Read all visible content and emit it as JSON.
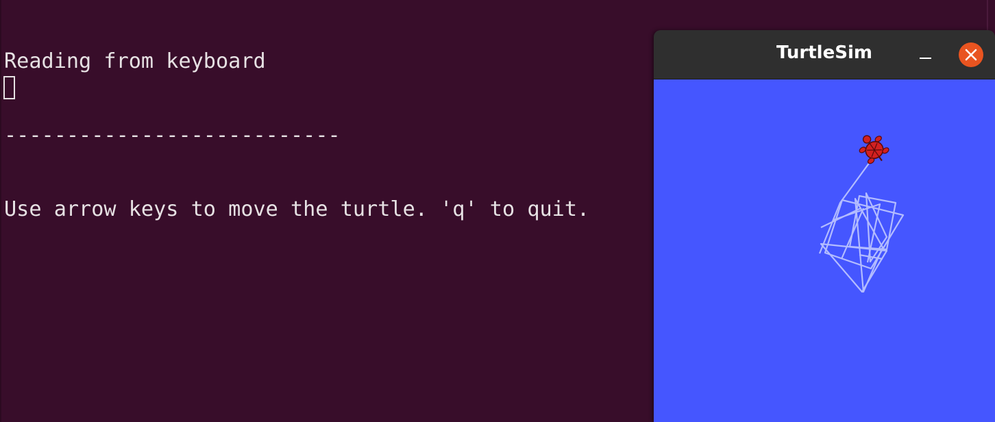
{
  "terminal": {
    "lines": [
      "Reading from keyboard",
      "---------------------------",
      "Use arrow keys to move the turtle. 'q' to quit."
    ],
    "background": "#380d2a",
    "text_color": "#e6e1e3"
  },
  "turtlesim": {
    "title": "TurtleSim",
    "canvas_background": "#4556ff",
    "path_color": "#b3bcff",
    "turtle_color": "#d22020",
    "close_button_color": "#e95420",
    "icons": {
      "minimize": "minimize-icon",
      "close": "close-icon",
      "turtle": "turtle-icon"
    }
  }
}
